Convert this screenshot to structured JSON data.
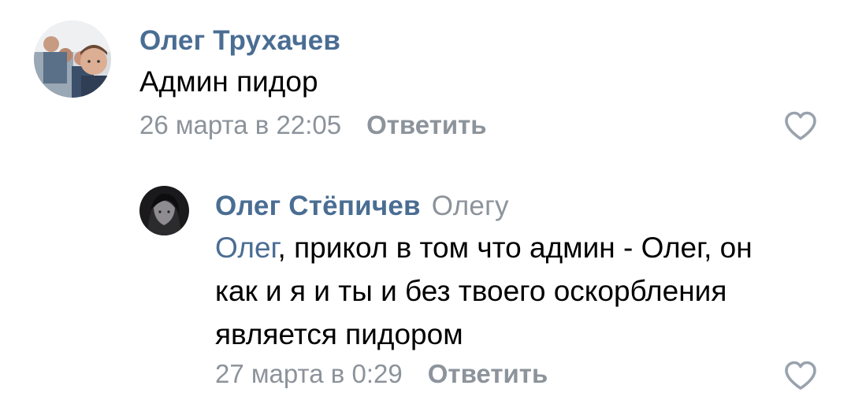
{
  "comments": [
    {
      "author": "Олег Трухачев",
      "text": "Админ пидор",
      "date": "26 марта в 22:05",
      "reply_label": "Ответить",
      "like_icon": "heart-outline-icon"
    }
  ],
  "reply": {
    "author": "Олег Стёпичев",
    "reply_to": "Олегу",
    "mention": "Олег",
    "text_line1_rest": ", прикол в том что админ - Олег, он",
    "text_line2": "как и я и ты и без твоего оскорбления",
    "text_line3": "является пидором",
    "date": "27 марта в 0:29",
    "reply_label": "Ответить",
    "like_icon": "heart-outline-icon"
  },
  "colors": {
    "link": "#4a6d93",
    "secondary": "#8c939b",
    "text": "#000000"
  }
}
